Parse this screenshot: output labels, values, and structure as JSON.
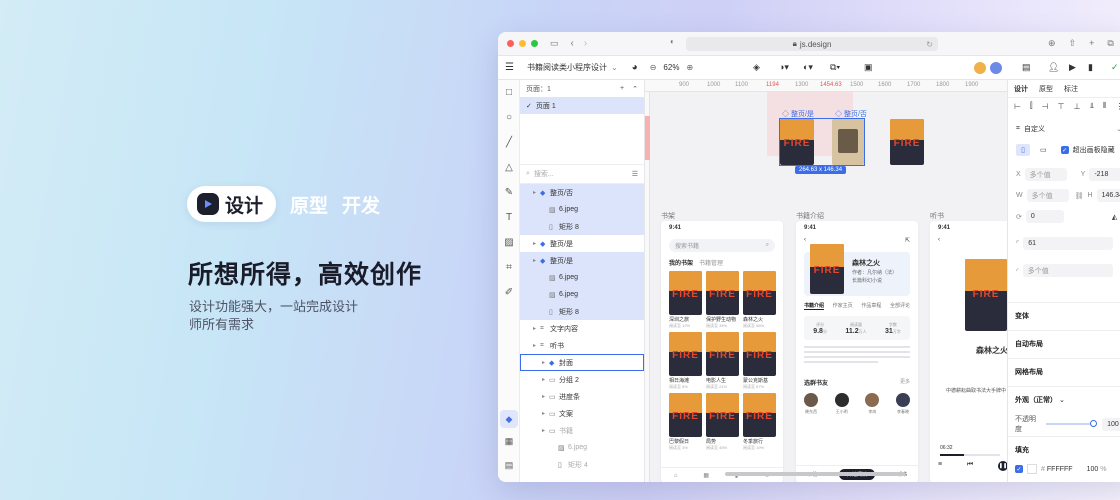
{
  "hero": {
    "pill_label": "设计",
    "tab2": "原型",
    "tab3": "开发",
    "headline": "所想所得，高效创作",
    "subline": "设计功能强大，一站完成设计师所有需求"
  },
  "browser": {
    "url": "js.design"
  },
  "toolbar": {
    "file_name": "书籍阅读类小程序设计",
    "zoom": "62%"
  },
  "layers": {
    "pages_label": "页面：1",
    "page_item": "页面 1",
    "search_placeholder": "搜索...",
    "items": [
      {
        "label": "整页/否",
        "depth": 1,
        "sel": true,
        "kind": "comp"
      },
      {
        "label": "6.jpeg",
        "depth": 2,
        "sel": true,
        "kind": "img"
      },
      {
        "label": "矩形 8",
        "depth": 2,
        "sel": true,
        "kind": "rect"
      },
      {
        "label": "整页/是",
        "depth": 1,
        "sel": false,
        "kind": "comp"
      },
      {
        "label": "整页/是",
        "depth": 1,
        "sel": true,
        "kind": "comp"
      },
      {
        "label": "6.jpeg",
        "depth": 2,
        "sel": true,
        "kind": "img"
      },
      {
        "label": "6.jpeg",
        "depth": 2,
        "sel": true,
        "kind": "img"
      },
      {
        "label": "矩形 8",
        "depth": 2,
        "sel": true,
        "kind": "rect"
      },
      {
        "label": "文字内容",
        "depth": 1,
        "sel": false,
        "kind": "frame"
      },
      {
        "label": "听书",
        "depth": 1,
        "sel": false,
        "kind": "frame"
      },
      {
        "label": "封面",
        "depth": 2,
        "sel": false,
        "kind": "comp",
        "outline": true
      },
      {
        "label": "分组 2",
        "depth": 2,
        "sel": false,
        "kind": "folder"
      },
      {
        "label": "进度条",
        "depth": 2,
        "sel": false,
        "kind": "folder"
      },
      {
        "label": "文案",
        "depth": 2,
        "sel": false,
        "kind": "folder"
      },
      {
        "label": "书籍",
        "depth": 2,
        "sel": false,
        "kind": "folder",
        "dim": true
      },
      {
        "label": "6.jpeg",
        "depth": 3,
        "sel": false,
        "kind": "img",
        "dim": true
      },
      {
        "label": "矩形 4",
        "depth": 3,
        "sel": false,
        "kind": "rect",
        "dim": true
      }
    ]
  },
  "canvas": {
    "ruler_ticks": [
      "900",
      "1000",
      "1100",
      "1194",
      "1300",
      "1454.63",
      "1500",
      "1600",
      "1700",
      "1800",
      "1900"
    ],
    "comp_label_1": "整页/是",
    "comp_label_2": "整页/否",
    "size_badge": "264.63 x 146.34",
    "frames": [
      "书架",
      "书籍介绍",
      "听书"
    ],
    "time": "9:41",
    "shelf": {
      "search": "搜索书籍",
      "my_shelf": "我的书架",
      "recent": "书籍管理",
      "books": [
        {
          "title": "深圳之旅",
          "sub": "阅读至 12%"
        },
        {
          "title": "保护野生动物",
          "sub": "阅读至 34%"
        },
        {
          "title": "森林之火",
          "sub": "阅读至 56%"
        },
        {
          "title": "相日海滩",
          "sub": "阅读至 8%"
        },
        {
          "title": "电影人生",
          "sub": "阅读至 21%"
        },
        {
          "title": "蒙公克斯基",
          "sub": "阅读至 67%"
        },
        {
          "title": "巴黎假日",
          "sub": "阅读至 3%"
        },
        {
          "title": "局势",
          "sub": "阅读至 45%"
        },
        {
          "title": "冬季旅行",
          "sub": "阅读至 19%"
        }
      ]
    },
    "detail": {
      "book_title": "森林之火",
      "author": "作者：凡尔纳（法）",
      "publisher": "长篇科幻小说",
      "tabs": [
        "书籍介绍",
        "作家主页",
        "作品章程",
        "全部评论"
      ],
      "stats": [
        {
          "label": "评分",
          "value": "9.8",
          "unit": "分"
        },
        {
          "label": "阅读量",
          "value": "11.2",
          "unit": "万人"
        },
        {
          "label": "字数",
          "value": "31",
          "unit": "万字"
        }
      ],
      "recommend": "选群书友",
      "recommend_more": "更多",
      "readers": [
        "晓东西",
        "王小明",
        "李冉",
        "李春晓"
      ],
      "bottom": [
        "下载",
        "开始阅读",
        "听书"
      ]
    },
    "audio": {
      "title": "森林之火",
      "line": "中德耕耘曲取书法大手牌中",
      "time": "06:32"
    }
  },
  "properties": {
    "tabs": [
      "设计",
      "原型",
      "标注"
    ],
    "preset": "自定义",
    "clip_label": "超出画板隐藏",
    "x_label": "X",
    "x_value": "多个值",
    "y_label": "Y",
    "y_value": "-218",
    "w_label": "W",
    "w_value": "多个值",
    "h_label": "H",
    "h_value": "146.34",
    "rot_value": "0",
    "radius_value": "61",
    "stroke_placeholder": "多个值",
    "sections": [
      "变体",
      "自动布局",
      "网格布局"
    ],
    "appearance": "外观（正常）",
    "opacity_label": "不透明度",
    "opacity_value": "100",
    "opacity_unit": "%",
    "fill_label": "填充",
    "fill_hex": "FFFFFF",
    "fill_opacity": "100",
    "fill_unit": "%"
  }
}
